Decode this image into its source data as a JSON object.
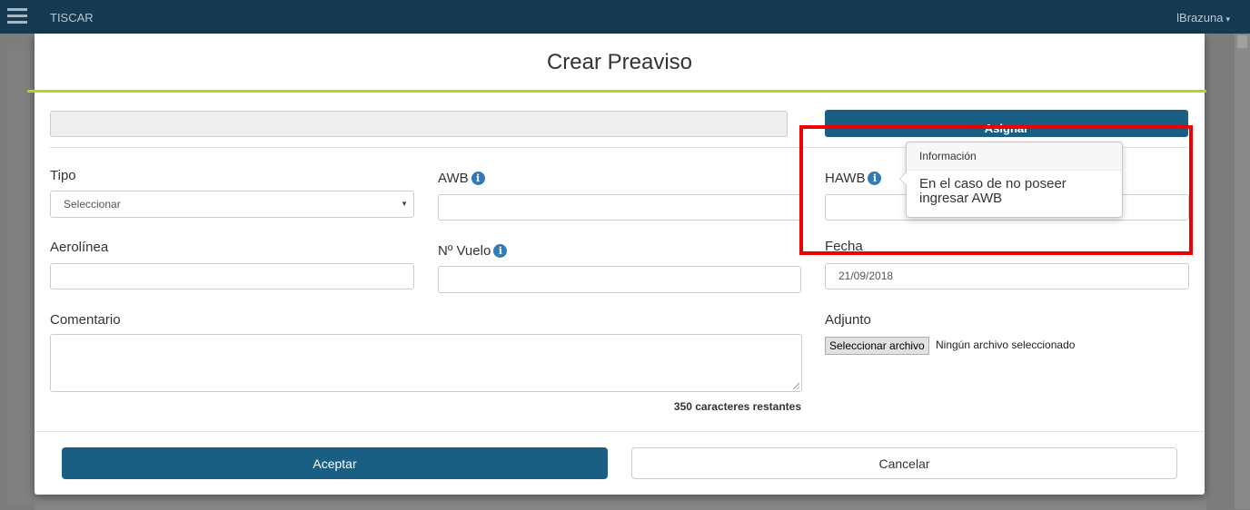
{
  "topbar": {
    "app_title": "TISCAR",
    "user_name": "lBrazuna",
    "caret": "▾"
  },
  "modal": {
    "title": "Crear Preaviso",
    "assign_label": "Asignar",
    "tipo": {
      "label": "Tipo",
      "value": "Seleccionar",
      "arrow": "▼"
    },
    "awb": {
      "label": "AWB",
      "value": ""
    },
    "hawb": {
      "label": "HAWB",
      "value": ""
    },
    "aerolinea": {
      "label": "Aerolínea",
      "value": ""
    },
    "vuelo": {
      "label": "Nº Vuelo",
      "value": ""
    },
    "fecha": {
      "label": "Fecha",
      "value": "21/09/2018"
    },
    "comentario": {
      "label": "Comentario",
      "counter": "350 caracteres restantes"
    },
    "adjunto": {
      "label": "Adjunto",
      "button": "Seleccionar archivo",
      "status": "Ningún archivo seleccionado"
    },
    "info_glyph": "i",
    "accept_label": "Aceptar",
    "cancel_label": "Cancelar"
  },
  "popover": {
    "title": "Información",
    "body": "En el caso de no poseer ingresar AWB"
  },
  "colors": {
    "primary": "#1a5e84",
    "accent_line": "#b9d01c",
    "highlight": "#ee0000",
    "info": "#337ab7"
  }
}
